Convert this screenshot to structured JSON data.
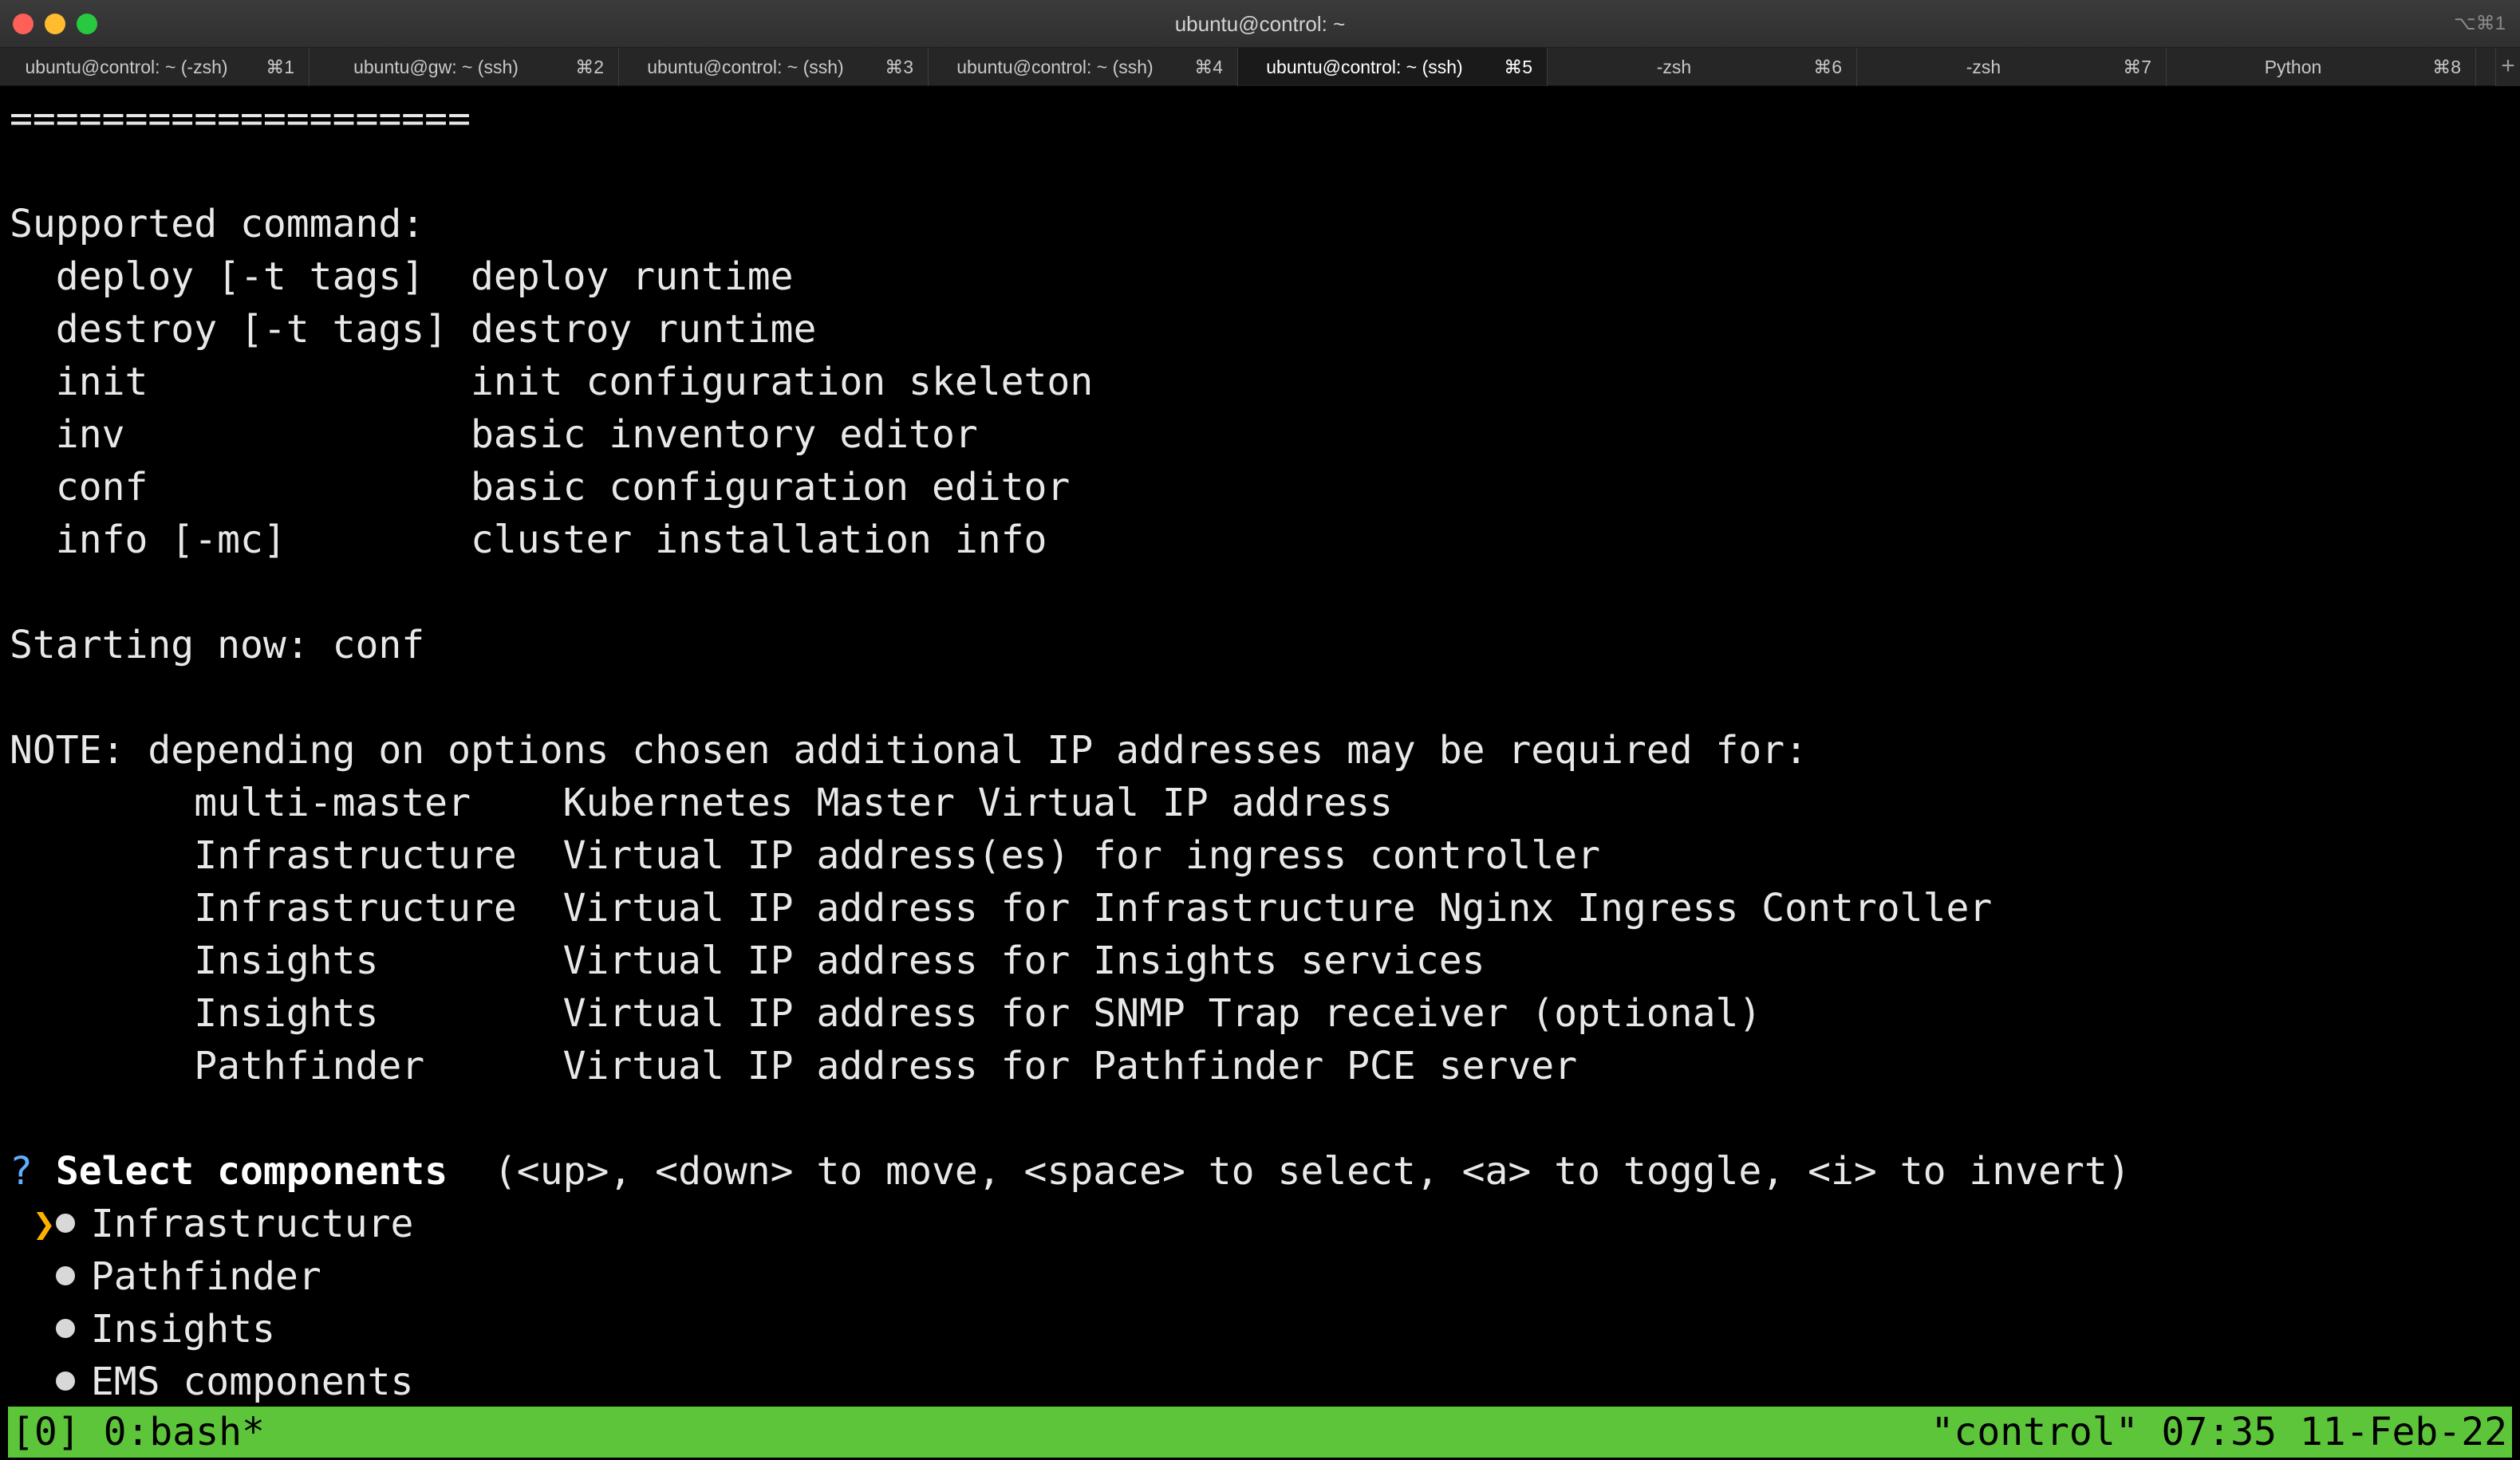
{
  "window": {
    "title": "ubuntu@control: ~",
    "shortcut": "⌥⌘1"
  },
  "tabs": [
    {
      "label": "ubuntu@control: ~ (-zsh)",
      "key": "⌘1",
      "active": false
    },
    {
      "label": "ubuntu@gw: ~ (ssh)",
      "key": "⌘2",
      "active": false
    },
    {
      "label": "ubuntu@control: ~ (ssh)",
      "key": "⌘3",
      "active": false
    },
    {
      "label": "ubuntu@control: ~ (ssh)",
      "key": "⌘4",
      "active": false
    },
    {
      "label": "ubuntu@control: ~ (ssh)",
      "key": "⌘5",
      "active": true
    },
    {
      "label": "-zsh",
      "key": "⌘6",
      "active": false
    },
    {
      "label": "-zsh",
      "key": "⌘7",
      "active": false
    },
    {
      "label": "Python",
      "key": "⌘8",
      "active": false
    }
  ],
  "tab_add_label": "+",
  "terminal": {
    "separator": "====================",
    "supported_header": "Supported command:",
    "commands": [
      {
        "name": "deploy [-t tags]",
        "desc": "deploy runtime"
      },
      {
        "name": "destroy [-t tags]",
        "desc": "destroy runtime"
      },
      {
        "name": "init",
        "desc": "init configuration skeleton"
      },
      {
        "name": "inv",
        "desc": "basic inventory editor"
      },
      {
        "name": "conf",
        "desc": "basic configuration editor"
      },
      {
        "name": "info [-mc]",
        "desc": "cluster installation info"
      }
    ],
    "starting": "Starting now: conf",
    "note": "NOTE: depending on options chosen additional IP addresses may be required for:",
    "ip_requirements": [
      {
        "component": "multi-master",
        "desc": "Kubernetes Master Virtual IP address"
      },
      {
        "component": "Infrastructure",
        "desc": "Virtual IP address(es) for ingress controller"
      },
      {
        "component": "Infrastructure",
        "desc": "Virtual IP address for Infrastructure Nginx Ingress Controller"
      },
      {
        "component": "Insights",
        "desc": "Virtual IP address for Insights services"
      },
      {
        "component": "Insights",
        "desc": "Virtual IP address for SNMP Trap receiver (optional)"
      },
      {
        "component": "Pathfinder",
        "desc": "Virtual IP address for Pathfinder PCE server"
      }
    ],
    "prompt": {
      "marker": "?",
      "title": "Select components",
      "hint": "(<up>, <down> to move, <space> to select, <a> to toggle, <i> to invert)",
      "cursor": "❯",
      "options": [
        "Infrastructure",
        "Pathfinder",
        "Insights",
        "EMS components"
      ],
      "cursor_index": 0
    }
  },
  "statusbar": {
    "left": "[0] 0:bash*",
    "right": "\"control\" 07:35 11-Feb-22"
  }
}
